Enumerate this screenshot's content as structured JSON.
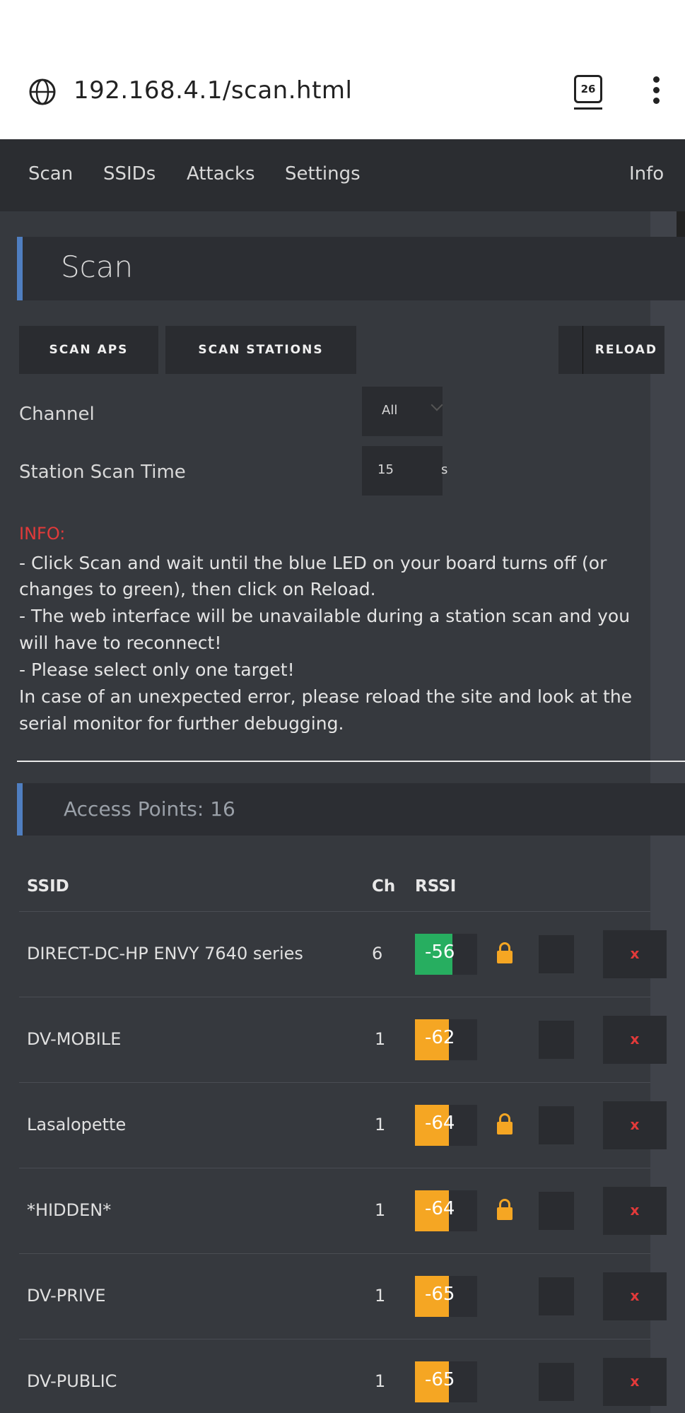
{
  "browser": {
    "url": "192.168.4.1/scan.html",
    "tab_count": "26"
  },
  "nav": {
    "items": [
      "Scan",
      "SSIDs",
      "Attacks",
      "Settings"
    ],
    "info": "Info"
  },
  "scan": {
    "title": "Scan",
    "buttons": {
      "scan_aps": "SCAN APS",
      "scan_stations": "SCAN STATIONS",
      "reload": "RELOAD"
    },
    "channel_label": "Channel",
    "channel_value": "All",
    "scan_time_label": "Station Scan Time",
    "scan_time_value": "15",
    "scan_time_unit": "s"
  },
  "info": {
    "title": "INFO:",
    "lines": [
      "- Click Scan and wait until the blue LED on your board turns off (or",
      "changes to green), then click on Reload.",
      "- The web interface will be unavailable during a station scan and you",
      "will have to reconnect!",
      "- Please select only one target!",
      "In case of an unexpected error, please reload the site and look at the",
      "serial monitor for further debugging."
    ]
  },
  "access_points": {
    "title": "Access Points: 16",
    "headers": {
      "ssid": "SSID",
      "ch": "Ch",
      "rssi": "RSSI"
    },
    "delete_label": "x",
    "rows": [
      {
        "ssid": "DIRECT-DC-HP ENVY 7640 series",
        "ch": "6",
        "rssi": "-56",
        "rssi_fill_pct": 60,
        "rssi_color": "#27ae60",
        "locked": true
      },
      {
        "ssid": "DV-MOBILE",
        "ch": "1",
        "rssi": "-62",
        "rssi_fill_pct": 54,
        "rssi_color": "#f5a623",
        "locked": false
      },
      {
        "ssid": "Lasalopette",
        "ch": "1",
        "rssi": "-64",
        "rssi_fill_pct": 54,
        "rssi_color": "#f5a623",
        "locked": true
      },
      {
        "ssid": "*HIDDEN*",
        "ch": "1",
        "rssi": "-64",
        "rssi_fill_pct": 54,
        "rssi_color": "#f5a623",
        "locked": true
      },
      {
        "ssid": "DV-PRIVE",
        "ch": "1",
        "rssi": "-65",
        "rssi_fill_pct": 54,
        "rssi_color": "#f5a623",
        "locked": false
      },
      {
        "ssid": "DV-PUBLIC",
        "ch": "1",
        "rssi": "-65",
        "rssi_fill_pct": 54,
        "rssi_color": "#f5a623",
        "locked": false
      }
    ]
  }
}
